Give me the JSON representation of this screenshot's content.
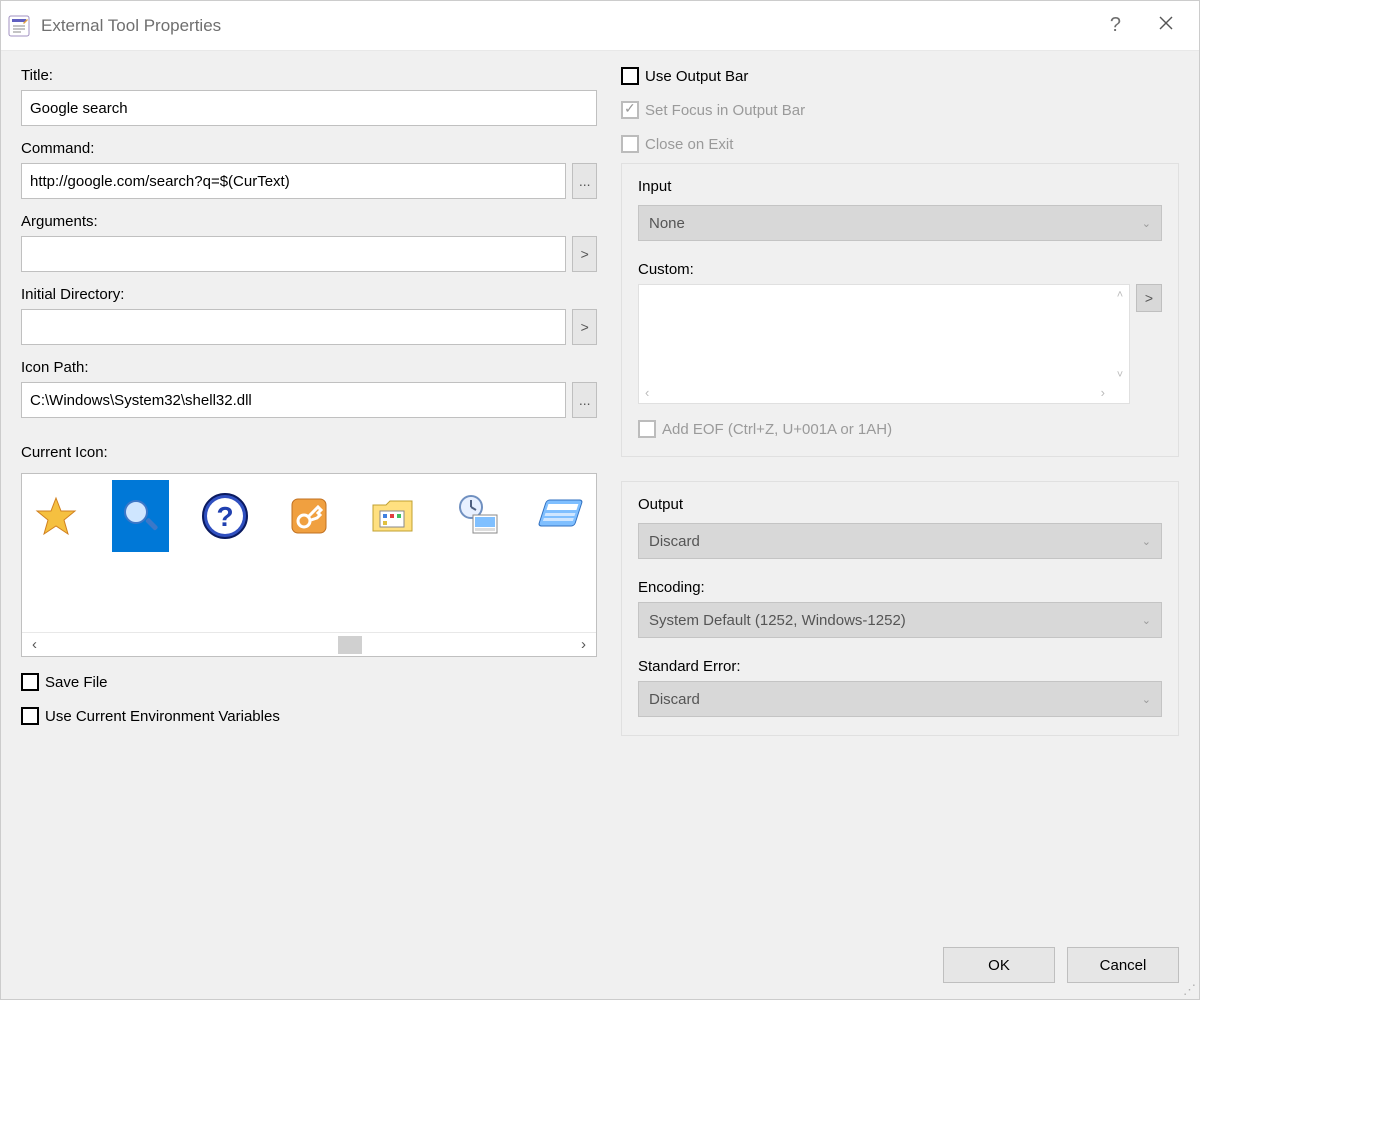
{
  "window": {
    "title": "External Tool Properties"
  },
  "left": {
    "title_label": "Title:",
    "title_value": "Google search",
    "command_label": "Command:",
    "command_value": "http://google.com/search?q=$(CurText)",
    "arguments_label": "Arguments:",
    "arguments_value": "",
    "initdir_label": "Initial Directory:",
    "initdir_value": "",
    "iconpath_label": "Icon Path:",
    "iconpath_value": "C:\\Windows\\System32\\shell32.dll",
    "currenticon_label": "Current Icon:",
    "savefile_label": "Save File",
    "envvars_label": "Use Current Environment Variables",
    "browse_glyph": "...",
    "more_glyph": ">"
  },
  "right": {
    "useoutput_label": "Use Output Bar",
    "setfocus_label": "Set Focus in Output Bar",
    "closeexit_label": "Close on Exit",
    "input_group": "Input",
    "input_combo": "None",
    "custom_label": "Custom:",
    "addeof_label": "Add EOF (Ctrl+Z, U+001A or 1AH)",
    "output_group": "Output",
    "output_combo": "Discard",
    "encoding_label": "Encoding:",
    "encoding_combo": "System Default (1252, Windows-1252)",
    "stderr_label": "Standard Error:",
    "stderr_combo": "Discard"
  },
  "buttons": {
    "ok": "OK",
    "cancel": "Cancel"
  }
}
